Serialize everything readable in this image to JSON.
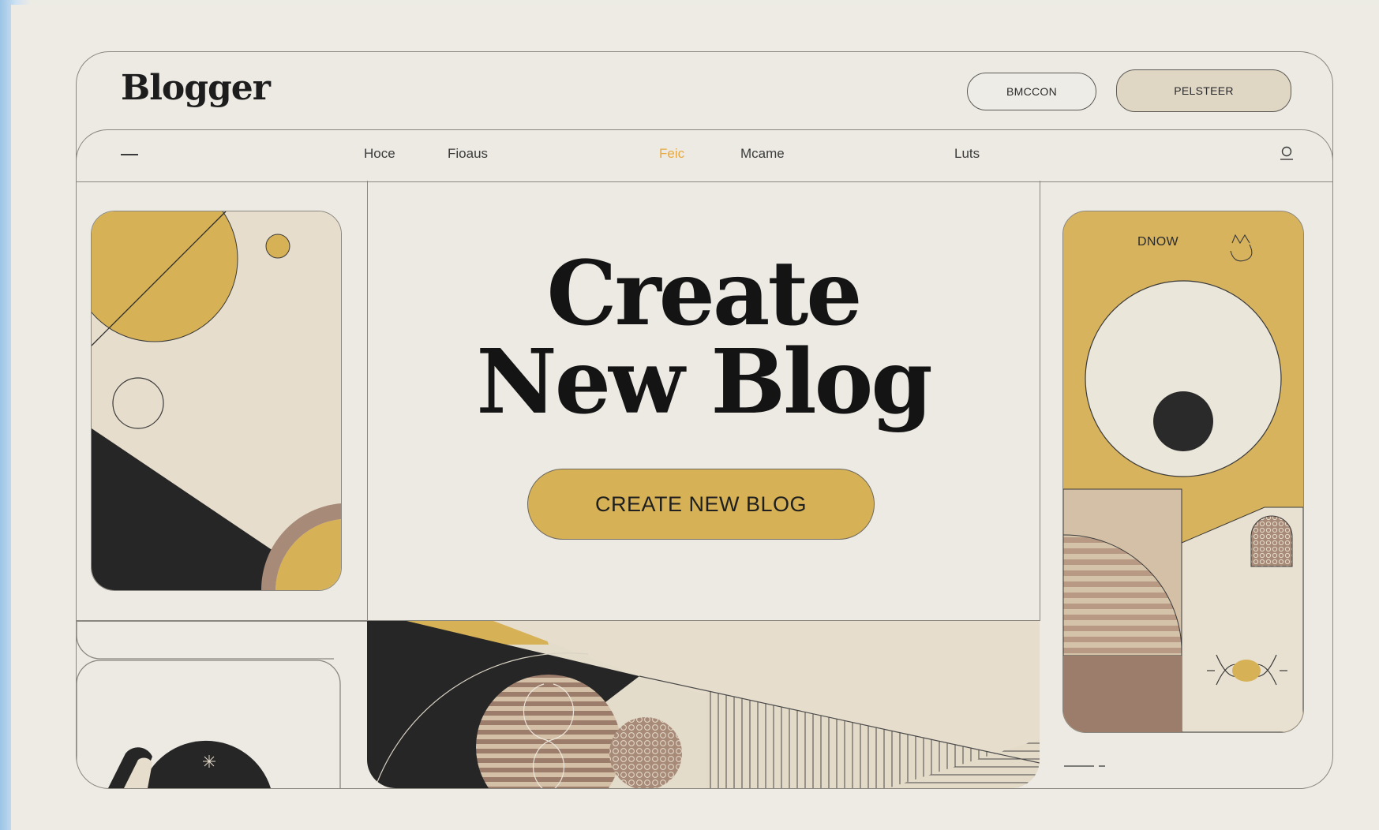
{
  "header": {
    "logo": "Blogger",
    "button_outline_label": "BMCCON",
    "button_filled_label": "PELSTEER"
  },
  "nav": {
    "items": [
      {
        "label": "Hoce",
        "active": false
      },
      {
        "label": "Fioaus",
        "active": false
      },
      {
        "label": "Feic",
        "active": true
      },
      {
        "label": "Mcame",
        "active": false
      },
      {
        "label": "Luts",
        "active": false
      }
    ]
  },
  "hero": {
    "title_line1": "Create",
    "title_line2": "New Blog",
    "cta_label": "CREATE NEW BLOG"
  },
  "right_card": {
    "label": "DNOW"
  },
  "colors": {
    "accent_gold": "#d6b155",
    "nav_active": "#e8a93d",
    "ink": "#141414",
    "taupe": "#9c7c6a",
    "sand": "#d8c8b0"
  }
}
